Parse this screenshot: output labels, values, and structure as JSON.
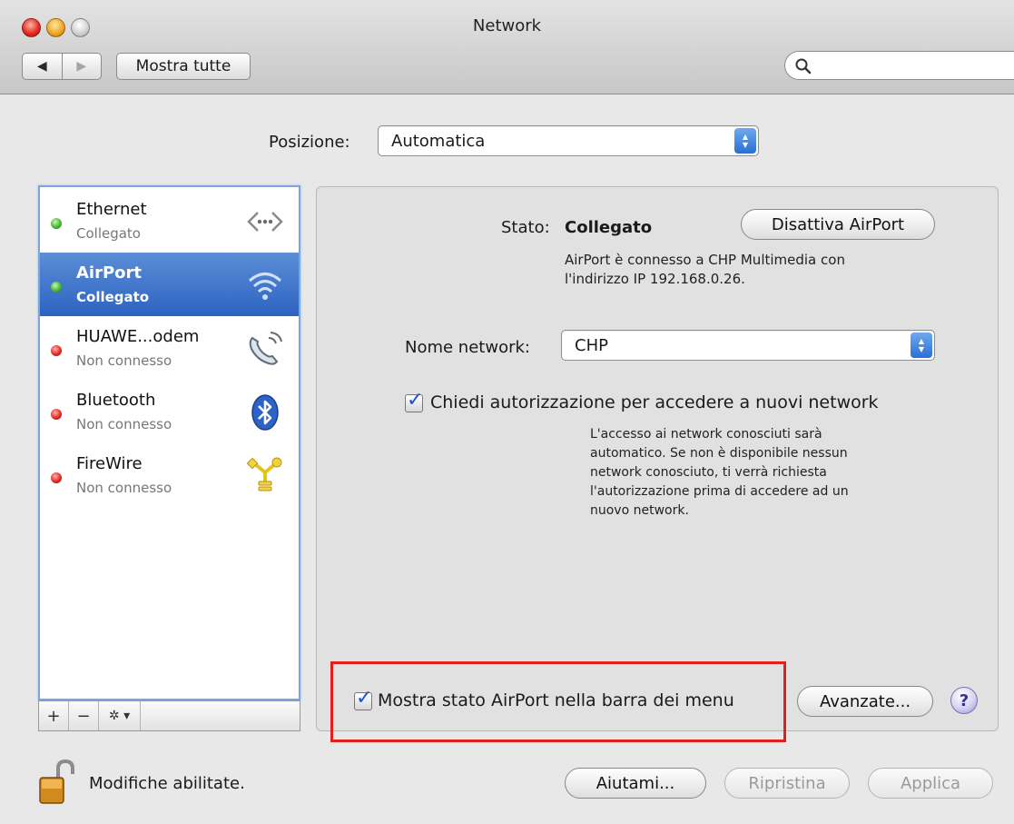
{
  "window": {
    "title": "Network"
  },
  "toolbar": {
    "back_glyph": "◀",
    "forward_glyph": "▶",
    "show_all_label": "Mostra tutte",
    "search_placeholder": ""
  },
  "location": {
    "label": "Posizione:",
    "value": "Automatica"
  },
  "services": [
    {
      "name": "Ethernet",
      "status": "Collegato",
      "status_color": "green",
      "icon": "ethernet-icon",
      "selected": false
    },
    {
      "name": "AirPort",
      "status": "Collegato",
      "status_color": "green",
      "icon": "airport-wifi-icon",
      "selected": true
    },
    {
      "name": "HUAWE...odem",
      "status": "Non connesso",
      "status_color": "red",
      "icon": "phone-modem-icon",
      "selected": false
    },
    {
      "name": "Bluetooth",
      "status": "Non connesso",
      "status_color": "red",
      "icon": "bluetooth-icon",
      "selected": false
    },
    {
      "name": "FireWire",
      "status": "Non connesso",
      "status_color": "red",
      "icon": "firewire-icon",
      "selected": false
    }
  ],
  "sidebar_tools": {
    "add": "+",
    "remove": "−",
    "action": "✲ ▾"
  },
  "detail": {
    "status_label": "Stato:",
    "status_value": "Collegato",
    "toggle_button": "Disattiva AirPort",
    "status_description_1": "AirPort è connesso a CHP Multimedia con",
    "status_description_2": "l'indirizzo IP 192.168.0.26.",
    "network_name_label": "Nome network:",
    "network_name_value": "CHP",
    "ask_join_label": "Chiedi autorizzazione per accedere a nuovi network",
    "ask_join_checked": true,
    "ask_join_note": [
      "L'accesso ai network conosciuti sarà",
      "automatico. Se non è disponibile nessun",
      "network conosciuto, ti verrà richiesta",
      "l'autorizzazione prima di accedere ad un",
      "nuovo network."
    ],
    "show_menu_status_label": "Mostra stato AirPort nella barra dei menu",
    "show_menu_status_checked": true,
    "advanced_button": "Avanzate...",
    "help_glyph": "?"
  },
  "footer": {
    "lock_label": "Modifiche abilitate.",
    "assist_button": "Aiutami...",
    "revert_button": "Ripristina",
    "apply_button": "Applica"
  },
  "colors": {
    "selection": "#2c63c1",
    "highlight_box": "#e0211b",
    "status_green": "#3fb12a",
    "status_red": "#e0201b"
  }
}
